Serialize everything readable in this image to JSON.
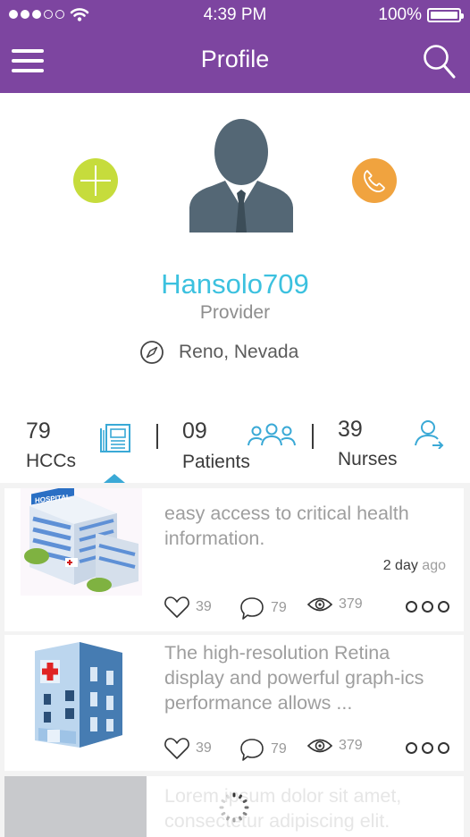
{
  "status_bar": {
    "time": "4:39 PM",
    "battery": "100%"
  },
  "nav": {
    "title": "Profile"
  },
  "profile": {
    "username": "Hansolo709",
    "role": "Provider",
    "location": "Reno, Nevada"
  },
  "stats": [
    {
      "count": "79",
      "label": "HCCs"
    },
    {
      "count": "09",
      "label": "Patients"
    },
    {
      "count": "39",
      "label": "Nurses"
    }
  ],
  "feed": [
    {
      "text": "easy access to critical health information.",
      "age_value": "2 day",
      "age_unit": "ago",
      "likes": "39",
      "comments": "79",
      "views": "379"
    },
    {
      "text": "The high-resolution Retina display and powerful graph-ics performance allows ...",
      "likes": "39",
      "comments": "79",
      "views": "379"
    },
    {
      "text": "Lorem ipsum dolor sit amet, consectetur adipiscing elit."
    }
  ],
  "colors": {
    "nav_bar": "#7d45a0",
    "accent": "#3cc1df",
    "add": "#c6dc3c",
    "call": "#f0a33f",
    "avatar": "#546775"
  }
}
